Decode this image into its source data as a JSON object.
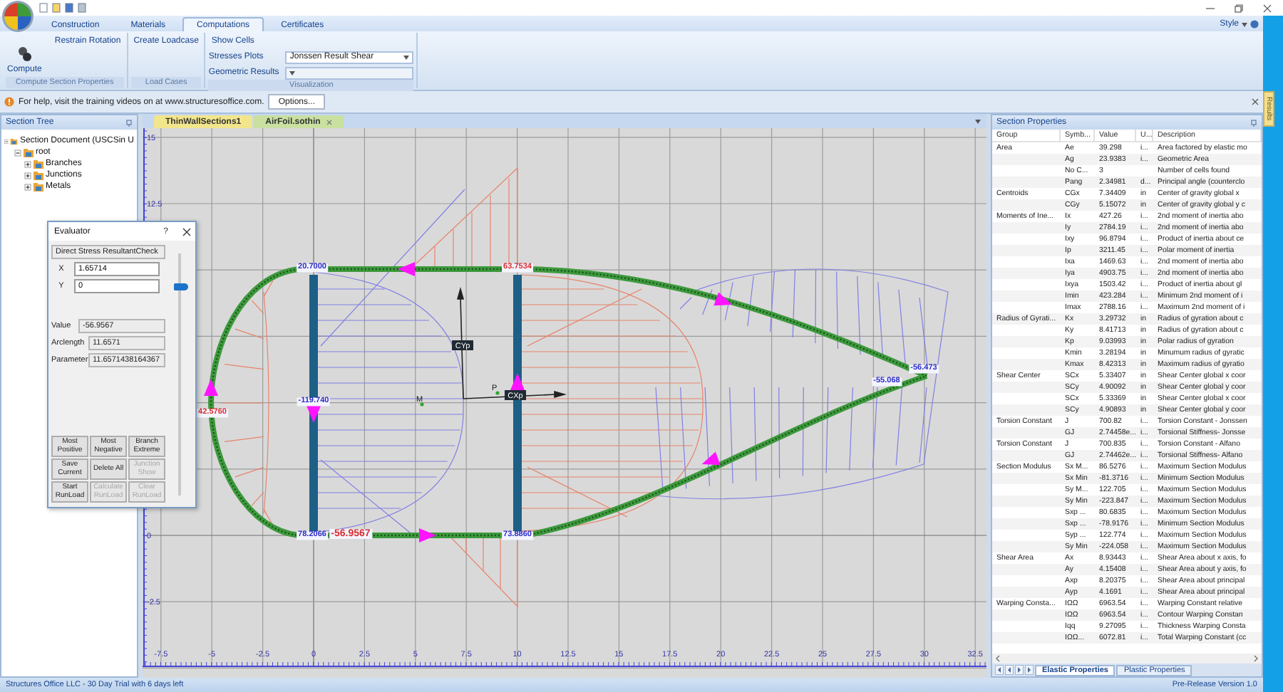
{
  "ribbon": {
    "tabs": [
      {
        "label": "Construction",
        "selected": false
      },
      {
        "label": "Materials",
        "selected": false
      },
      {
        "label": "Computations",
        "selected": true
      },
      {
        "label": "Certificates",
        "selected": false
      }
    ],
    "style_menu": "Style",
    "groups": [
      {
        "label": "Compute Section Properties",
        "large_button": "Compute",
        "buttons": [
          "Restrain Rotation"
        ]
      },
      {
        "label": "Load Cases",
        "buttons": [
          "Create Loadcase"
        ]
      },
      {
        "label": "Visualization",
        "buttons": [
          "Show Cells"
        ],
        "dropdowns": [
          {
            "label": "Stresses Plots",
            "value": "Jonssen Result Shear"
          },
          {
            "label": "Geometric Results"
          }
        ]
      }
    ]
  },
  "help_bar": {
    "message": "For help, visit the training videos on at www.structuresoffice.com.",
    "button": "Options..."
  },
  "section_tree": {
    "title": "Section Tree",
    "items": [
      {
        "label": "Section Document (USCSin U",
        "expanded": true,
        "children": [
          {
            "label": "root",
            "expanded": true,
            "children": [
              {
                "label": "Branches",
                "expanded": false
              },
              {
                "label": "Junctions",
                "expanded": false
              },
              {
                "label": "Metals",
                "expanded": false
              }
            ]
          }
        ]
      }
    ]
  },
  "documents": [
    {
      "label": "ThinWallSections1",
      "selected": false
    },
    {
      "label": "AirFoil.sothin",
      "selected": true
    }
  ],
  "canvas": {
    "x_axis_labels": [
      "-7.5",
      "-5",
      "-2.5",
      "0",
      "2.5",
      "5",
      "7.5",
      "10",
      "12.5",
      "15",
      "17.5",
      "20",
      "22.5",
      "25",
      "27.5",
      "30",
      "32.5"
    ],
    "y_axis_labels": [
      "15",
      "12.5",
      "0",
      "-2.5"
    ],
    "node_values": [
      {
        "text": "20.7000",
        "color": "#2b2bc4",
        "selected": false
      },
      {
        "text": "63.7534",
        "color": "#d83030",
        "selected": false
      },
      {
        "text": "-119.740",
        "color": "#2b2bc4",
        "selected": false
      },
      {
        "text": "42.5760",
        "color": "#d83030",
        "selected": false
      },
      {
        "text": "78.2066",
        "color": "#2b2bc4",
        "selected": false
      },
      {
        "text": "-56.9567",
        "color": "#d83030",
        "selected": true
      },
      {
        "text": "73.8860",
        "color": "#2b2bc4",
        "selected": false
      },
      {
        "text": "-55.068",
        "color": "#2b2bc4",
        "selected": false
      },
      {
        "text": "-56.473",
        "color": "#2b2bc4",
        "selected": false
      }
    ],
    "axis_labels": [
      "CYp",
      "CXp"
    ],
    "points": [
      "M",
      "P"
    ]
  },
  "evaluator": {
    "title": "Evaluator",
    "help": "?",
    "result_type": "Direct Stress ResultantCheck",
    "x": {
      "label": "X",
      "value": "1.65714"
    },
    "y": {
      "label": "Y",
      "value": "0"
    },
    "readouts": [
      {
        "label": "Value",
        "value": "-56.9567"
      },
      {
        "label": "Arclength",
        "value": "11.6571"
      },
      {
        "label": "Parameter",
        "value": "11.6571438164367"
      }
    ],
    "slider": {
      "level": 0.87
    },
    "buttons": [
      {
        "label": "Most Positive",
        "disabled": false
      },
      {
        "label": "Most Negative",
        "disabled": false
      },
      {
        "label": "Branch Extreme",
        "disabled": false
      },
      {
        "label": "Save Current",
        "disabled": false
      },
      {
        "label": "Delete All",
        "disabled": false
      },
      {
        "label": "Junction Show",
        "disabled": true
      },
      {
        "label": "Start RunLoad",
        "disabled": false
      },
      {
        "label": "Calculate RunLoad",
        "disabled": true
      },
      {
        "label": "Clear RunLoad",
        "disabled": true
      }
    ]
  },
  "section_properties": {
    "title": "Section Properties",
    "columns": [
      "Group",
      "Symb...",
      "Value",
      "U...",
      "Description"
    ],
    "rows": [
      {
        "group": "Area",
        "symbol": "Ae",
        "value": "39.298",
        "unit": "i...",
        "description": "Area factored by elastic mo"
      },
      {
        "symbol": "Ag",
        "value": "23.9383",
        "unit": "i...",
        "description": "Geometric Area"
      },
      {
        "symbol": "No C...",
        "value": "3",
        "description": "Number of cells found"
      },
      {
        "symbol": "Pang",
        "value": "2.34981",
        "unit": "d...",
        "description": "Principal angle (counterclo"
      },
      {
        "group": "Centroids",
        "symbol": "CGx",
        "value": "7.34409",
        "unit": "in",
        "description": "Center of gravity global x"
      },
      {
        "symbol": "CGy",
        "value": "5.15072",
        "unit": "in",
        "description": "Center of gravity global y c"
      },
      {
        "group": "Moments of Ine...",
        "symbol": "Ix",
        "value": "427.26",
        "unit": "i...",
        "description": "2nd moment of inertia abo"
      },
      {
        "symbol": "Iy",
        "value": "2784.19",
        "unit": "i...",
        "description": "2nd moment of inertia abo"
      },
      {
        "symbol": "Ixy",
        "value": "96.8794",
        "unit": "i...",
        "description": "Product of inertia about ce"
      },
      {
        "symbol": "Ip",
        "value": "3211.45",
        "unit": "i...",
        "description": "Polar moment of inertia"
      },
      {
        "symbol": "Ixa",
        "value": "1469.63",
        "unit": "i...",
        "description": "2nd moment of inertia abo"
      },
      {
        "symbol": "Iya",
        "value": "4903.75",
        "unit": "i...",
        "description": "2nd moment of inertia abo"
      },
      {
        "symbol": "Ixya",
        "value": "1503.42",
        "unit": "i...",
        "description": "Product of inertia about gl"
      },
      {
        "symbol": "Imin",
        "value": "423.284",
        "unit": "i...",
        "description": "Minimum 2nd moment of i"
      },
      {
        "symbol": "Imax",
        "value": "2788.16",
        "unit": "i...",
        "description": "Maximum 2nd moment of i"
      },
      {
        "group": "Radius of Gyrati...",
        "symbol": "Kx",
        "value": "3.29732",
        "unit": "in",
        "description": "Radius of gyration about c"
      },
      {
        "symbol": "Ky",
        "value": "8.41713",
        "unit": "in",
        "description": "Radius of gyration about c"
      },
      {
        "symbol": "Kp",
        "value": "9.03993",
        "unit": "in",
        "description": "Polar radius of gyration"
      },
      {
        "symbol": "Kmin",
        "value": "3.28194",
        "unit": "in",
        "description": "Minumum radius of gyratic"
      },
      {
        "symbol": "Kmax",
        "value": "8.42313",
        "unit": "in",
        "description": "Maximum radius of gyratio"
      },
      {
        "group": "Shear Center",
        "symbol": "SCx",
        "value": "5.33407",
        "unit": "in",
        "description": "Shear Center global x coor"
      },
      {
        "symbol": "SCy",
        "value": "4.90092",
        "unit": "in",
        "description": "Shear Center global y coor"
      },
      {
        "symbol": "SCx",
        "value": "5.33369",
        "unit": "in",
        "description": "Shear Center global x coor"
      },
      {
        "symbol": "SCy",
        "value": "4.90893",
        "unit": "in",
        "description": "Shear Center global y coor"
      },
      {
        "group": "Torsion Constant",
        "symbol": "J",
        "value": "700.82",
        "unit": "i...",
        "description": "Torsion Constant - Jonssen"
      },
      {
        "symbol": "GJ",
        "value": "2.74458e...",
        "unit": "i...",
        "description": "Torsional Stiffness- Jonsse"
      },
      {
        "group": "Torsion Constant",
        "symbol": "J",
        "value": "700.835",
        "unit": "i...",
        "description": "Torsion Constant - Alfano"
      },
      {
        "symbol": "GJ",
        "value": "2.74462e...",
        "unit": "i...",
        "description": "Torsional Stiffness- Alfano"
      },
      {
        "group": "Section Modulus",
        "symbol": "Sx M...",
        "value": "86.5276",
        "unit": "i...",
        "description": "Maximum Section Modulus"
      },
      {
        "symbol": "Sx Min",
        "value": "-81.3716",
        "unit": "i...",
        "description": "Minimum Section Modulus"
      },
      {
        "symbol": "Sy M...",
        "value": "122.705",
        "unit": "i...",
        "description": "Maximum Section Modulus"
      },
      {
        "symbol": "Sy Min",
        "value": "-223.847",
        "unit": "i...",
        "description": "Maximum Section Modulus"
      },
      {
        "symbol": "Sxp ...",
        "value": "80.6835",
        "unit": "i...",
        "description": "Maximum Section Modulus"
      },
      {
        "symbol": "Sxp ...",
        "value": "-78.9176",
        "unit": "i...",
        "description": "Minimum Section Modulus"
      },
      {
        "symbol": "Syp ...",
        "value": "122.774",
        "unit": "i...",
        "description": "Maximum Section Modulus"
      },
      {
        "symbol": "Sy Min",
        "value": "-224.058",
        "unit": "i...",
        "description": "Maximum Section Modulus"
      },
      {
        "group": "Shear Area",
        "symbol": "Ax",
        "value": "8.93443",
        "unit": "i...",
        "description": "Shear Area about x axis, fo"
      },
      {
        "symbol": "Ay",
        "value": "4.15408",
        "unit": "i...",
        "description": "Shear Area about y axis, fo"
      },
      {
        "symbol": "Axp",
        "value": "8.20375",
        "unit": "i...",
        "description": "Shear Area about principal"
      },
      {
        "symbol": "Ayp",
        "value": "4.1691",
        "unit": "i...",
        "description": "Shear Area about principal"
      },
      {
        "group": "Warping Consta...",
        "symbol": "IΩΩ",
        "value": "6963.54",
        "unit": "i...",
        "description": "Warping Constant relative"
      },
      {
        "symbol": "IΩΩ",
        "value": "6963.54",
        "unit": "i...",
        "description": "Contour Warping Constan"
      },
      {
        "symbol": "Iqq",
        "value": "9.27095",
        "unit": "i...",
        "description": "Thickness Warping Consta"
      },
      {
        "symbol": "IΩΩ...",
        "value": "6072.81",
        "unit": "i...",
        "description": "Total Warping Constant (cc"
      }
    ],
    "tabs": [
      {
        "label": "Elastic Properties",
        "selected": true
      },
      {
        "label": "Plastic Properties",
        "selected": false
      }
    ]
  },
  "status_bar": {
    "left": "Structures Office LLC - 30 Day Trial with 6 days left",
    "right": "Pre-Release Version 1.0"
  },
  "side_tab": "Results"
}
